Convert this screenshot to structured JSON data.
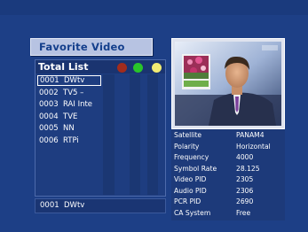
{
  "screen": {
    "title": "Favorite Video"
  },
  "channel_list": {
    "title": "Total List",
    "color_keys": {
      "red": "#a22c1c",
      "green": "#29c42a",
      "yellow": "#f2ec73"
    },
    "channels": [
      {
        "number": "0001",
        "name": "DWtv",
        "selected": true
      },
      {
        "number": "0002",
        "name": "TV5 –",
        "selected": false
      },
      {
        "number": "0003",
        "name": "RAI Inte",
        "selected": false
      },
      {
        "number": "0004",
        "name": "TVE",
        "selected": false
      },
      {
        "number": "0005",
        "name": "NN",
        "selected": false
      },
      {
        "number": "0006",
        "name": "RTPi",
        "selected": false
      }
    ]
  },
  "status": {
    "number": "0001",
    "name": "DWtv"
  },
  "preview": {
    "description": "news-anchor-video"
  },
  "info": {
    "rows": [
      {
        "label": "Satellite",
        "value": "PANAM4"
      },
      {
        "label": "Polarity",
        "value": "Horizontal"
      },
      {
        "label": "Frequency",
        "value": "4000"
      },
      {
        "label": "Symbol Rate",
        "value": "28.125"
      },
      {
        "label": "Video PID",
        "value": "2305"
      },
      {
        "label": "Audio PID",
        "value": "2306"
      },
      {
        "label": "PCR PID",
        "value": "2690"
      },
      {
        "label": "CA System",
        "value": "Free"
      }
    ]
  }
}
